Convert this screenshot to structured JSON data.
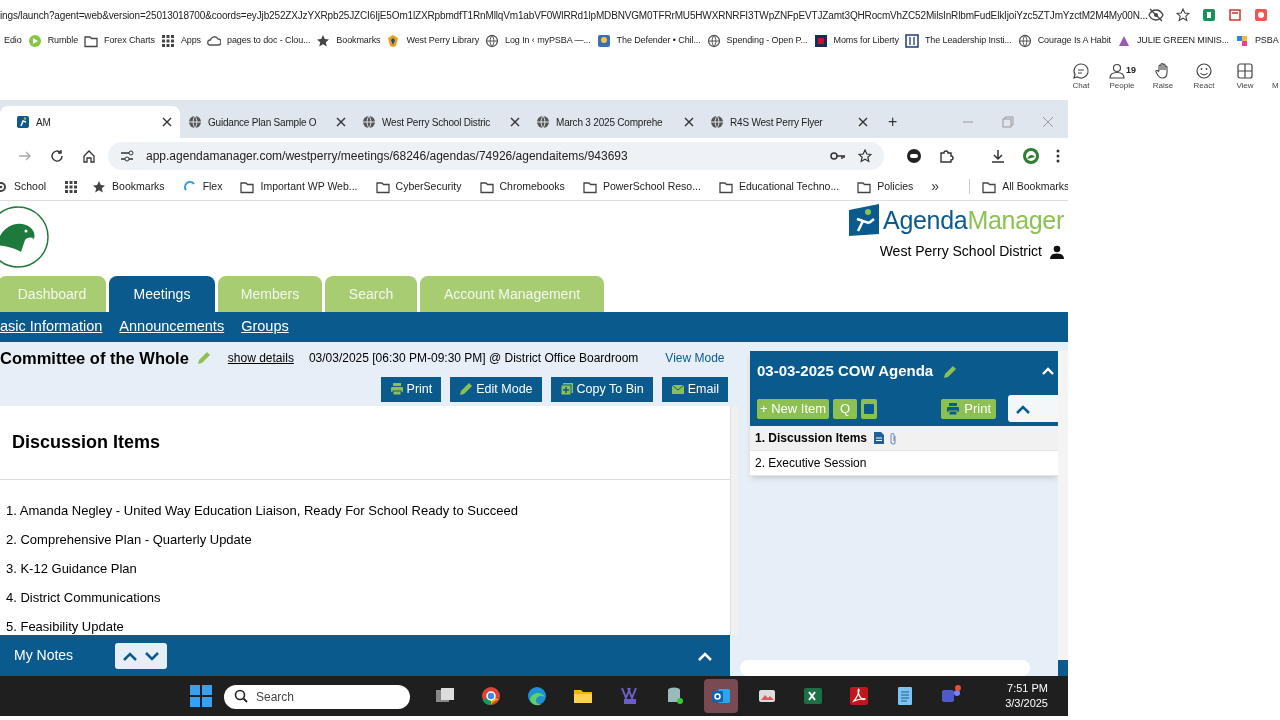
{
  "outer_browser": {
    "url": "ings/launch?agent=web&version=25013018700&coords=eyJjb252ZXJzYXRpb25JZCI6IjE5Om1lZXRpbmdfT1RnMllqVm1abVF0WlRRd1lpMDBNVGM0TFRrMU5HWXRNRFI3TWpZNFpEVTJZamt3QHRocmVhZC52MilsInRlbmFudElkIjoiYzc5ZTJmYzctM2M4My00N...",
    "bookmarks": [
      {
        "kind": "none",
        "label": "Edio"
      },
      {
        "kind": "play",
        "label": "Rumble"
      },
      {
        "kind": "folder",
        "label": "Forex Charts"
      },
      {
        "kind": "grid",
        "label": "Apps"
      },
      {
        "kind": "cloud",
        "label": "pages to doc - Clou..."
      },
      {
        "kind": "star",
        "label": "Bookmarks"
      },
      {
        "kind": "shield",
        "label": "West Perry Library"
      },
      {
        "kind": "globe",
        "label": "Log In ‹ myPSBA —..."
      },
      {
        "kind": "image",
        "label": "The Defender • Chil..."
      },
      {
        "kind": "globe",
        "label": "Spending - Open P..."
      },
      {
        "kind": "flag",
        "label": "Moms for Liberty"
      },
      {
        "kind": "book",
        "label": "The Leadership Insti..."
      },
      {
        "kind": "globe",
        "label": "Courage Is A Habit"
      },
      {
        "kind": "cat",
        "label": "JULIE GREEN MINIS..."
      },
      {
        "kind": "puzzle",
        "label": "PSBA"
      }
    ]
  },
  "meeting_toolbar": [
    {
      "kind": "chat",
      "label": "Chat"
    },
    {
      "kind": "people",
      "label": "People",
      "count": "19"
    },
    {
      "kind": "hand",
      "label": "Raise"
    },
    {
      "kind": "smile",
      "label": "React"
    },
    {
      "kind": "view",
      "label": "View"
    },
    {
      "kind": "more",
      "label": "M"
    }
  ],
  "browser": {
    "tabs": [
      {
        "title": "AM",
        "selected": true
      },
      {
        "title": "Guidance Plan Sample O",
        "selected": false
      },
      {
        "title": "West Perry School Distric",
        "selected": false
      },
      {
        "title": "March 3 2025 Comprehe",
        "selected": false
      },
      {
        "title": "R4S West Perry Flyer",
        "selected": false
      }
    ],
    "new_tab": "+",
    "url": "app.agendamanager.com/westperry/meetings/68246/agendas/74926/agendaitems/943693",
    "bookmarks": [
      {
        "kind": "gear",
        "label": "School"
      },
      {
        "kind": "grid"
      },
      {
        "kind": "star",
        "label": "Bookmarks"
      },
      {
        "kind": "flex",
        "label": "Flex"
      },
      {
        "kind": "folder",
        "label": "Important WP Web..."
      },
      {
        "kind": "folder",
        "label": "CyberSecurity"
      },
      {
        "kind": "folder",
        "label": "Chromebooks"
      },
      {
        "kind": "folder",
        "label": "PowerSchool Reso..."
      },
      {
        "kind": "folder",
        "label": "Educational Techno..."
      },
      {
        "kind": "folder",
        "label": "Policies"
      }
    ],
    "overflow": "»",
    "all_bookmarks": "All Bookmarks"
  },
  "site": {
    "brand_first": "Agenda",
    "brand_second": "Manager",
    "organization": "West Perry School District",
    "nav_tabs": [
      {
        "label": "Dashboard",
        "selected": false
      },
      {
        "label": "Meetings",
        "selected": true
      },
      {
        "label": "Members",
        "selected": false
      },
      {
        "label": "Search",
        "selected": false
      },
      {
        "label": "Account Management",
        "selected": false
      }
    ],
    "sub_nav": [
      "asic Information",
      "Announcements",
      "Groups"
    ]
  },
  "meeting": {
    "title": "Committee of the Whole",
    "show_details": "show details",
    "schedule": "03/03/2025 [06:30 PM-09:30 PM] @ District Office Boardroom",
    "mode": "View Mode",
    "actions": [
      {
        "kind": "print",
        "label": "Print"
      },
      {
        "kind": "edit",
        "label": "Edit Mode"
      },
      {
        "kind": "copy",
        "label": "Copy To Bin"
      },
      {
        "kind": "email",
        "label": "Email"
      }
    ]
  },
  "item": {
    "heading": "Discussion Items",
    "entries": [
      "1. Amanda Negley - United Way Education Liaison, Ready For School Ready to Succeed",
      "2. Comprehensive Plan - Quarterly Update",
      "3. K-12 Guidance Plan",
      "4. District Communications",
      "5. Feasibility Update"
    ]
  },
  "notes": {
    "title": "My Notes"
  },
  "agenda_panel": {
    "title": "03-03-2025 COW Agenda",
    "new_item": "+ New Item",
    "q": "Q",
    "print": "Print",
    "items": [
      {
        "number": "1.",
        "title": "Discussion Items",
        "selected": true,
        "has_document": true,
        "has_attachment": true
      },
      {
        "number": "2.",
        "title": "Executive Session",
        "selected": false,
        "has_document": false,
        "has_attachment": false
      }
    ]
  },
  "taskbar": {
    "search_placeholder": "Search",
    "time": "7:51 PM",
    "date": "3/3/2025",
    "apps": [
      {
        "kind": "taskview",
        "selected": false
      },
      {
        "kind": "chrome",
        "selected": false
      },
      {
        "kind": "edge",
        "selected": false
      },
      {
        "kind": "explorer",
        "selected": false
      },
      {
        "kind": "pst",
        "selected": false
      },
      {
        "kind": "database",
        "selected": false
      },
      {
        "kind": "outlook",
        "selected": true
      },
      {
        "kind": "photos",
        "selected": false
      },
      {
        "kind": "excel",
        "selected": false
      },
      {
        "kind": "acrobat",
        "selected": false
      },
      {
        "kind": "notepad",
        "selected": false
      },
      {
        "kind": "teams",
        "selected": false
      }
    ]
  }
}
